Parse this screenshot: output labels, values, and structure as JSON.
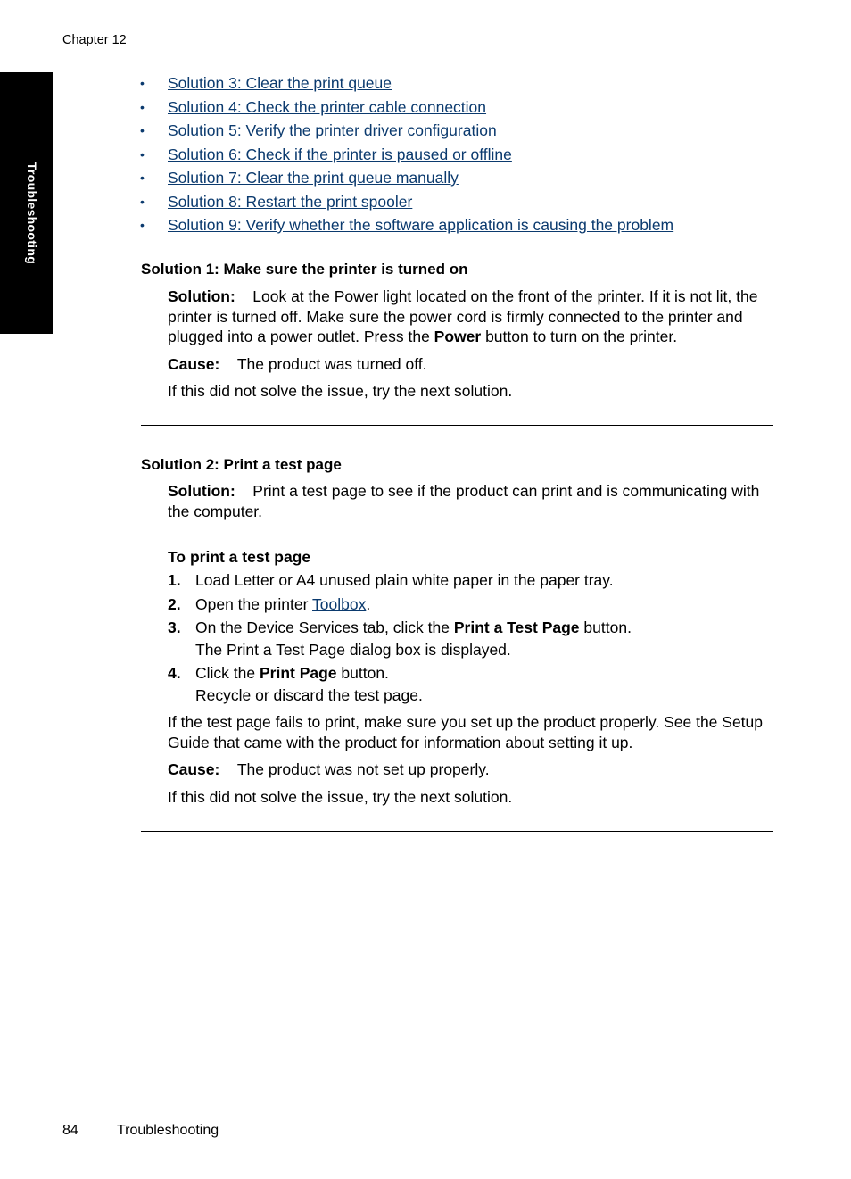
{
  "header": {
    "chapter": "Chapter 12"
  },
  "side_tab": {
    "label": "Troubleshooting"
  },
  "links": [
    "Solution 3: Clear the print queue",
    "Solution 4: Check the printer cable connection",
    "Solution 5: Verify the printer driver configuration",
    "Solution 6: Check if the printer is paused or offline",
    "Solution 7: Clear the print queue manually",
    "Solution 8: Restart the print spooler",
    "Solution 9: Verify whether the software application is causing the problem"
  ],
  "bullet": "•",
  "solution1": {
    "heading": "Solution 1: Make sure the printer is turned on",
    "solution_label": "Solution:",
    "solution_text_1": "Look at the Power light located on the front of the printer. If it is not lit, the printer is turned off. Make sure the power cord is firmly connected to the printer and plugged into a power outlet. Press the ",
    "solution_bold": "Power",
    "solution_text_2": " button to turn on the printer.",
    "cause_label": "Cause:",
    "cause_text": "The product was turned off.",
    "next": "If this did not solve the issue, try the next solution."
  },
  "solution2": {
    "heading": "Solution 2: Print a test page",
    "solution_label": "Solution:",
    "solution_text": "Print a test page to see if the product can print and is communicating with the computer.",
    "procedure_heading": "To print a test page",
    "steps": [
      {
        "num": "1.",
        "text": "Load Letter or A4 unused plain white paper in the paper tray."
      },
      {
        "num": "2.",
        "text_pre": "Open the printer ",
        "link": "Toolbox",
        "text_post": "."
      },
      {
        "num": "3.",
        "text_pre": "On the Device Services tab, click the ",
        "bold": "Print a Test Page",
        "text_post": " button.",
        "sub": "The Print a Test Page dialog box is displayed."
      },
      {
        "num": "4.",
        "text_pre": "Click the ",
        "bold": "Print Page",
        "text_post": " button.",
        "sub": "Recycle or discard the test page."
      }
    ],
    "note": "If the test page fails to print, make sure you set up the product properly. See the Setup Guide that came with the product for information about setting it up.",
    "cause_label": "Cause:",
    "cause_text": "The product was not set up properly.",
    "next": "If this did not solve the issue, try the next solution."
  },
  "footer": {
    "page_number": "84",
    "section": "Troubleshooting"
  }
}
